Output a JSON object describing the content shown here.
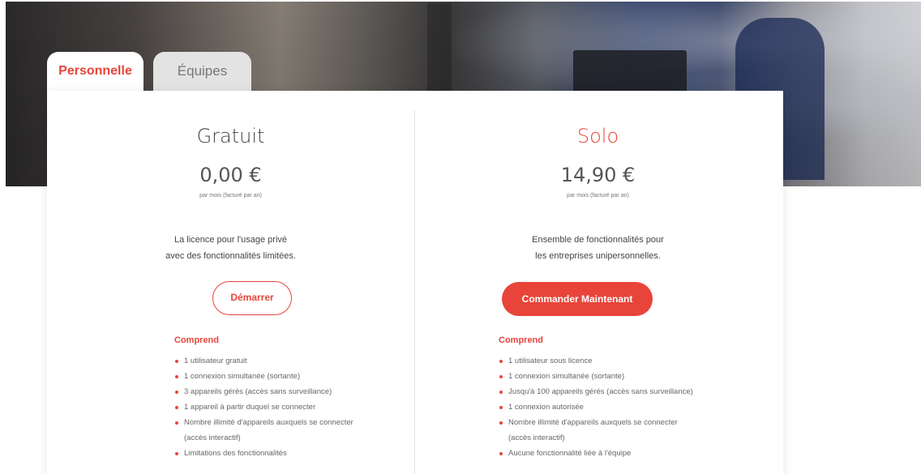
{
  "tabs": [
    {
      "label": "Personnelle",
      "active": true
    },
    {
      "label": "Équipes",
      "active": false
    }
  ],
  "colors": {
    "accent": "#e8443a"
  },
  "plans": [
    {
      "name": "Gratuit",
      "price": "0,00 €",
      "period": "par mois (facturé par an)",
      "description_line1": "La licence pour l'usage privé",
      "description_line2": "avec des fonctionnalités limitées.",
      "button": "Démarrer",
      "includes_title": "Comprend",
      "features": [
        "1 utilisateur gratuit",
        "1 connexion simultanée (sortante)",
        "3 appareils gérés (accès sans surveillance)",
        "1 appareil à partir duquel se connecter",
        "Nombre illimité d'appareils auxquels se connecter",
        "(accès interactif)",
        "Limitations des fonctionnalités"
      ]
    },
    {
      "name": "Solo",
      "price": "14,90 €",
      "period": "par mois (facturé par an)",
      "description_line1": "Ensemble de fonctionnalités pour",
      "description_line2": "les entreprises unipersonnelles.",
      "button": "Commander Maintenant",
      "includes_title": "Comprend",
      "features": [
        "1 utilisateur sous licence",
        "1 connexion simultanée (sortante)",
        "Jusqu'à 100 appareils gérés (accès sans surveillance)",
        "1 connexion autorisée",
        "Nombre illimité d'appareils auxquels se connecter",
        "(accès interactif)",
        "Aucune fonctionnalité liée à l'équipe"
      ]
    }
  ]
}
